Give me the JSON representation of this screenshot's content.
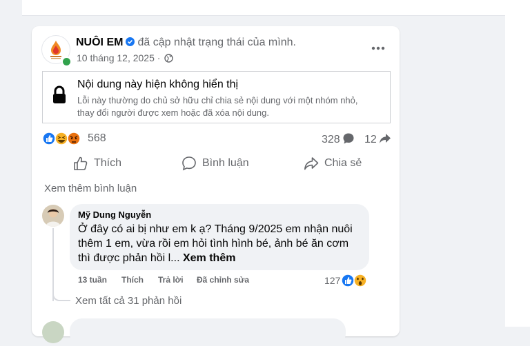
{
  "post": {
    "page_name": "NUÔI EM",
    "action_text": "đã cập nhật trạng thái của mình.",
    "date": "10 tháng 12, 2025 ·",
    "unavailable_title": "Nội dung này hiện không hiển thị",
    "unavailable_desc": "Lỗi này thường do chủ sở hữu chỉ chia sẻ nội dung với một nhóm nhỏ, thay đổi người được xem hoặc đã xóa nội dung.",
    "reaction_count": "568",
    "comment_count": "328",
    "share_count": "12",
    "icons": [
      "verified-badge",
      "globe",
      "more-horizontal",
      "lock",
      "like",
      "haha",
      "angry",
      "comment",
      "share"
    ]
  },
  "actions": {
    "like": "Thích",
    "comment": "Bình luận",
    "share": "Chia sẻ"
  },
  "comments": {
    "view_more": "Xem thêm bình luận",
    "item": {
      "author": "Mỹ Dung Nguyễn",
      "text": "Ở đây có ai bị như em k ạ? Tháng 9/2025 em nhận nuôi thêm 1 em, vừa rồi em hỏi tình hình bé, ảnh bé ăn cơm thì được phản hồi l...",
      "see_more": "Xem thêm",
      "time": "13 tuần",
      "like": "Thích",
      "reply": "Trả lời",
      "edited": "Đã chỉnh sửa",
      "reaction_count": "127"
    },
    "view_all_replies": "Xem tất cả 31 phản hồi"
  },
  "colors": {
    "blue": "#1877f2",
    "grey_text": "#65676b",
    "online": "#31a24c",
    "angry": "#e9710f",
    "haha": "#f7b125"
  }
}
